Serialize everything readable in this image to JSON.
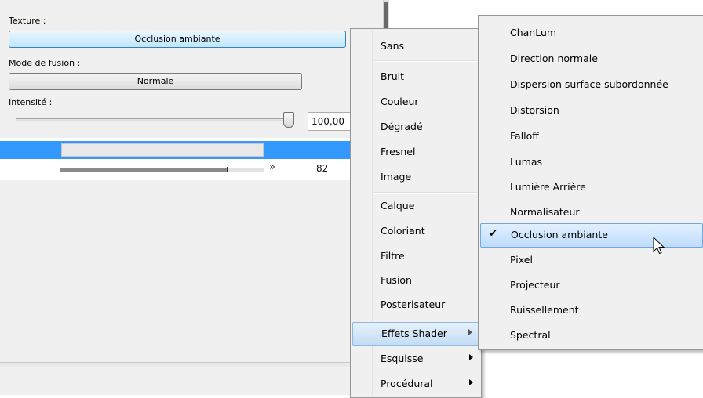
{
  "panel": {
    "texture_label": "Texture :",
    "texture_value": "Occlusion ambiante",
    "blend_label": "Mode de fusion :",
    "blend_value": "Normale",
    "intensity_label": "Intensité :",
    "intensity_value": "100,00",
    "intensity_level": 1.0,
    "row_value": "82",
    "row_progress": 0.82
  },
  "menu_primary": {
    "items": [
      {
        "label": "Sans"
      },
      {
        "label": "Bruit"
      },
      {
        "label": "Couleur"
      },
      {
        "label": "Dégradé"
      },
      {
        "label": "Fresnel"
      },
      {
        "label": "Image"
      },
      {
        "label": "Calque"
      },
      {
        "label": "Coloriant"
      },
      {
        "label": "Filtre"
      },
      {
        "label": "Fusion"
      },
      {
        "label": "Posterisateur"
      },
      {
        "label": "Effets Shader"
      },
      {
        "label": "Esquisse"
      },
      {
        "label": "Procédural"
      }
    ],
    "highlighted": "Effets Shader"
  },
  "menu_shader": {
    "items": [
      {
        "label": "ChanLum"
      },
      {
        "label": "Direction normale"
      },
      {
        "label": "Dispersion surface subordonnée"
      },
      {
        "label": "Distorsion"
      },
      {
        "label": "Falloff"
      },
      {
        "label": "Lumas"
      },
      {
        "label": "Lumière Arrière"
      },
      {
        "label": "Normalisateur"
      },
      {
        "label": "Occlusion ambiante"
      },
      {
        "label": "Pixel"
      },
      {
        "label": "Projecteur"
      },
      {
        "label": "Ruissellement"
      },
      {
        "label": "Spectral"
      }
    ],
    "checked": "Occlusion ambiante"
  },
  "colors": {
    "selection_blue": "#3399ff",
    "menu_bg": "#f0f0f0",
    "highlight_border": "#8fb8e4"
  }
}
